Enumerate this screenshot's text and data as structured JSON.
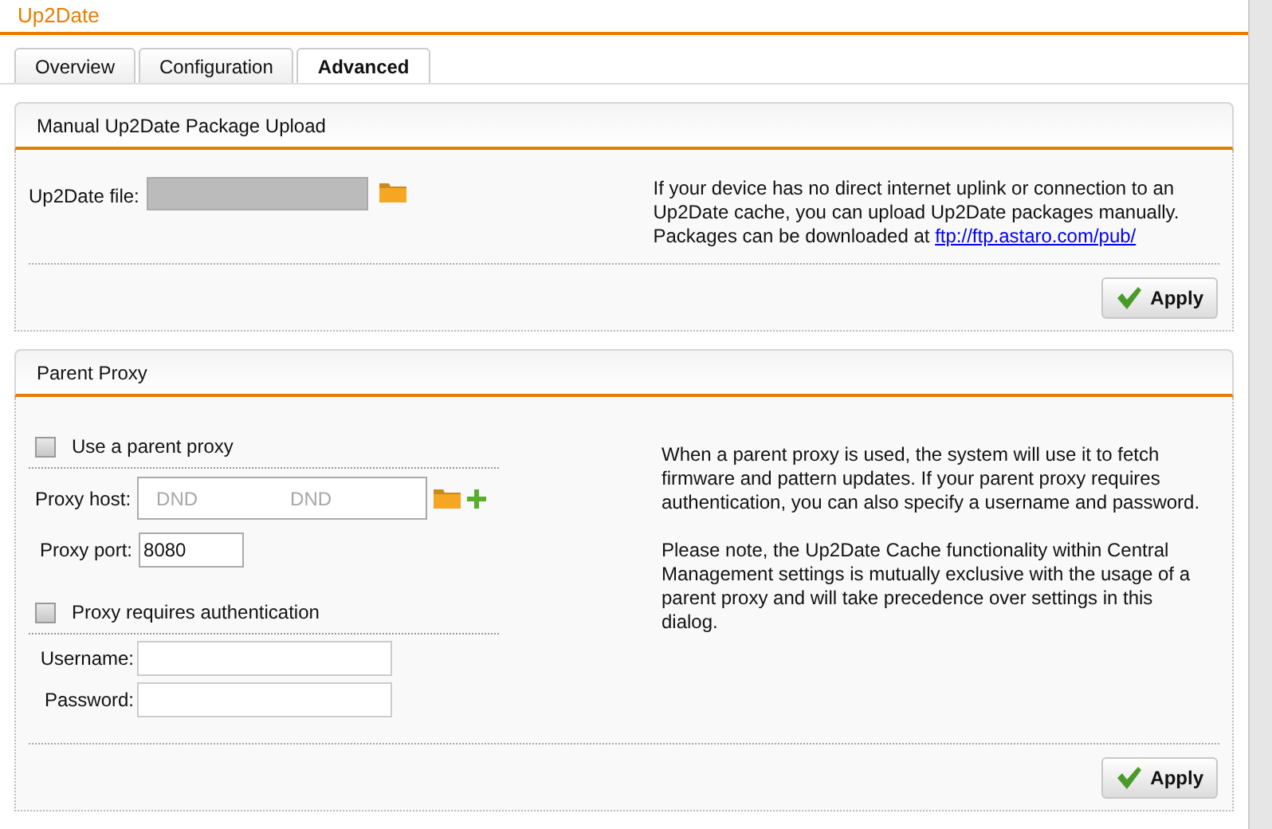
{
  "page_title": "Up2Date",
  "tabs": [
    {
      "label": "Overview",
      "selected": false
    },
    {
      "label": "Configuration",
      "selected": false
    },
    {
      "label": "Advanced",
      "selected": true
    }
  ],
  "upload_section": {
    "title": "Manual Up2Date Package Upload",
    "file_label": "Up2Date file:",
    "disabled": true,
    "help_text": "If your device has no direct internet uplink or connection to an Up2Date cache, you can upload Up2Date packages manually. Packages can be downloaded at",
    "help_link": "ftp://ftp.astaro.com/pub/",
    "button": "Apply"
  },
  "proxy_section": {
    "title": "Parent Proxy",
    "use_proxy": {
      "label": "Use a parent proxy",
      "checked": false
    },
    "host_label": "Proxy host:",
    "host_drop_hints": [
      "DND",
      "DND"
    ],
    "port_label": "Proxy port:",
    "port_value": "8080",
    "auth": {
      "label": "Proxy requires authentication",
      "checked": false
    },
    "username_label": "Username:",
    "password_label": "Password:",
    "help_paragraphs": [
      "When a parent proxy is used, the system will use it to fetch firmware and pattern updates. If your parent proxy requires authentication, you can also specify a username and password.",
      "Please note, the Up2Date Cache functionality within Central Management settings is mutually exclusive with the usage of a parent proxy and will take precedence over settings in this dialog."
    ],
    "button": "Apply"
  }
}
